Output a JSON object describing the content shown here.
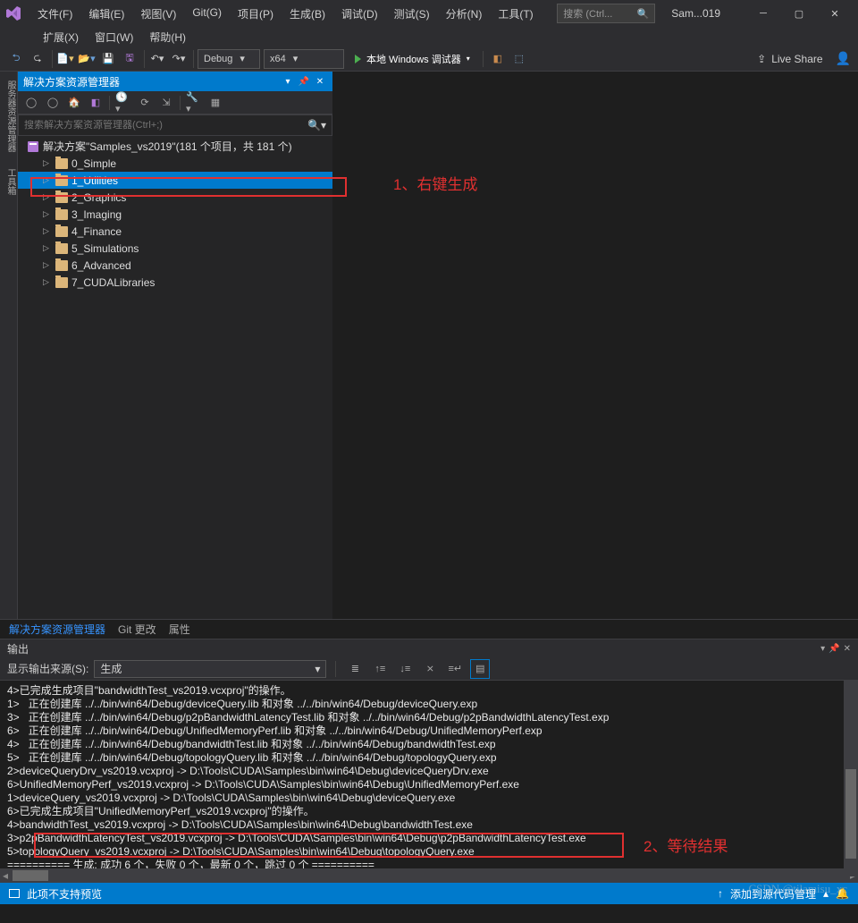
{
  "menu": {
    "items": [
      "文件(F)",
      "编辑(E)",
      "视图(V)",
      "Git(G)",
      "项目(P)",
      "生成(B)",
      "调试(D)",
      "测试(S)",
      "分析(N)",
      "工具(T)"
    ],
    "items2": [
      "扩展(X)",
      "窗口(W)",
      "帮助(H)"
    ]
  },
  "title_search_placeholder": "搜索 (Ctrl...",
  "doc_name": "Sam...019",
  "toolbar": {
    "config": "Debug",
    "platform": "x64",
    "start": "本地 Windows 调试器",
    "live_share": "Live Share"
  },
  "left_gutter": [
    "服务器资源管理器",
    "工具箱"
  ],
  "solution": {
    "title": "解决方案资源管理器",
    "search_placeholder": "搜索解决方案资源管理器(Ctrl+;)",
    "root": "解决方案\"Samples_vs2019\"(181 个项目，共 181 个)",
    "folders": [
      "0_Simple",
      "1_Utilities",
      "2_Graphics",
      "3_Imaging",
      "4_Finance",
      "5_Simulations",
      "6_Advanced",
      "7_CUDALibraries"
    ],
    "selected_index": 1
  },
  "annotation1": "1、右键生成",
  "bottom_tabs": {
    "items": [
      {
        "label": "解决方案资源管理器",
        "active": true
      },
      {
        "label": "Git 更改",
        "active": false
      },
      {
        "label": "属性",
        "active": false
      }
    ]
  },
  "output": {
    "title": "输出",
    "source_label": "显示输出来源(S):",
    "source_value": "生成",
    "lines": [
      "4>已完成生成项目\"bandwidthTest_vs2019.vcxproj\"的操作。",
      "1>   正在创建库 ../../bin/win64/Debug/deviceQuery.lib 和对象 ../../bin/win64/Debug/deviceQuery.exp",
      "3>   正在创建库 ../../bin/win64/Debug/p2pBandwidthLatencyTest.lib 和对象 ../../bin/win64/Debug/p2pBandwidthLatencyTest.exp",
      "6>   正在创建库 ../../bin/win64/Debug/UnifiedMemoryPerf.lib 和对象 ../../bin/win64/Debug/UnifiedMemoryPerf.exp",
      "4>   正在创建库 ../../bin/win64/Debug/bandwidthTest.lib 和对象 ../../bin/win64/Debug/bandwidthTest.exp",
      "5>   正在创建库 ../../bin/win64/Debug/topologyQuery.lib 和对象 ../../bin/win64/Debug/topologyQuery.exp",
      "2>deviceQueryDrv_vs2019.vcxproj -> D:\\Tools\\CUDA\\Samples\\bin\\win64\\Debug\\deviceQueryDrv.exe",
      "6>UnifiedMemoryPerf_vs2019.vcxproj -> D:\\Tools\\CUDA\\Samples\\bin\\win64\\Debug\\UnifiedMemoryPerf.exe",
      "1>deviceQuery_vs2019.vcxproj -> D:\\Tools\\CUDA\\Samples\\bin\\win64\\Debug\\deviceQuery.exe",
      "6>已完成生成项目\"UnifiedMemoryPerf_vs2019.vcxproj\"的操作。",
      "4>bandwidthTest_vs2019.vcxproj -> D:\\Tools\\CUDA\\Samples\\bin\\win64\\Debug\\bandwidthTest.exe",
      "3>p2pBandwidthLatencyTest_vs2019.vcxproj -> D:\\Tools\\CUDA\\Samples\\bin\\win64\\Debug\\p2pBandwidthLatencyTest.exe",
      "5>topologyQuery_vs2019.vcxproj -> D:\\Tools\\CUDA\\Samples\\bin\\win64\\Debug\\topologyQuery.exe",
      "========== 生成: 成功 6 个，失败 0 个，最新 0 个，跳过 0 个 =========="
    ]
  },
  "annotation2": "2、等待结果",
  "status": {
    "left": "此项不支持预览",
    "right": "添加到源代码管理",
    "watermark": "CSDN @tilamisu_xc"
  }
}
